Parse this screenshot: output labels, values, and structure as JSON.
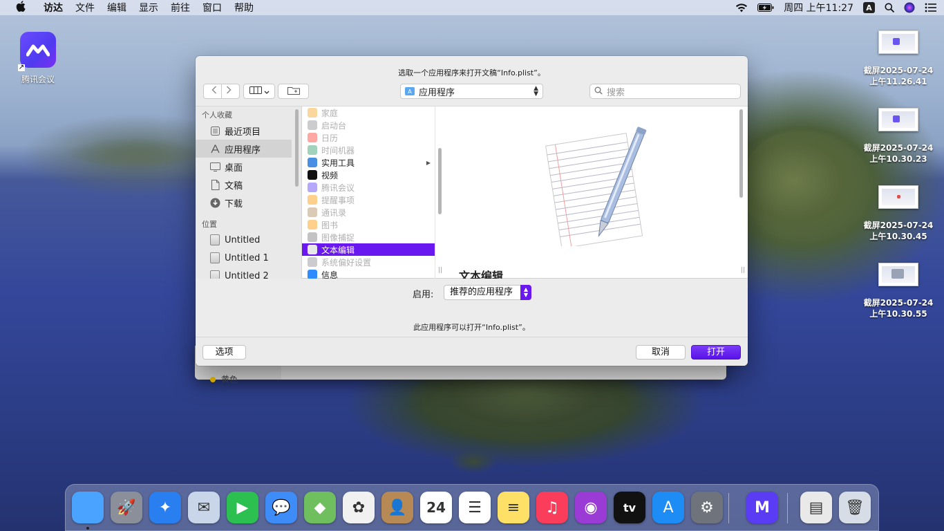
{
  "menubar": {
    "items": [
      "访达",
      "文件",
      "编辑",
      "显示",
      "前往",
      "窗口",
      "帮助"
    ],
    "clock": "周四 上午11:27",
    "input_method": "A"
  },
  "desktop": {
    "app_icon_label": "腾讯会议",
    "screenshots": [
      {
        "label_line1": "截屏2025-07-24",
        "label_line2": "上午11.26.41"
      },
      {
        "label_line1": "截屏2025-07-24",
        "label_line2": "上午10.30.23"
      },
      {
        "label_line1": "截屏2025-07-24",
        "label_line2": "上午10.30.45"
      },
      {
        "label_line1": "截屏2025-07-24",
        "label_line2": "上午10.30.55"
      }
    ]
  },
  "behind_window": {
    "sidebar_item": "黄色"
  },
  "dialog": {
    "title": "选取一个应用程序来打开文稿“Info.plist”。",
    "location": "应用程序",
    "search_placeholder": "搜索",
    "sidebar": {
      "favorites_header": "个人收藏",
      "favorites": [
        {
          "label": "最近项目",
          "icon": "clock-icon"
        },
        {
          "label": "应用程序",
          "icon": "applications-icon"
        },
        {
          "label": "桌面",
          "icon": "desktop-icon"
        },
        {
          "label": "文稿",
          "icon": "document-icon"
        },
        {
          "label": "下载",
          "icon": "download-icon"
        }
      ],
      "locations_header": "位置",
      "locations": [
        {
          "label": "Untitled",
          "icon": "disk-icon"
        },
        {
          "label": "Untitled 1",
          "icon": "disk-icon"
        },
        {
          "label": "Untitled 2",
          "icon": "disk-icon"
        }
      ]
    },
    "apps": [
      {
        "label": "家庭",
        "enabled": false,
        "color": "#f5a623"
      },
      {
        "label": "启动台",
        "enabled": false,
        "color": "#8e8e93"
      },
      {
        "label": "日历",
        "enabled": false,
        "color": "#ff3b30"
      },
      {
        "label": "时间机器",
        "enabled": false,
        "color": "#2f9e6a"
      },
      {
        "label": "实用工具",
        "enabled": true,
        "color": "#4a90e2",
        "folder": true
      },
      {
        "label": "视频",
        "enabled": true,
        "color": "#111111"
      },
      {
        "label": "腾讯会议",
        "enabled": false,
        "color": "#5b3cf5"
      },
      {
        "label": "提醒事项",
        "enabled": false,
        "color": "#ff9500"
      },
      {
        "label": "通讯录",
        "enabled": false,
        "color": "#b08a5a"
      },
      {
        "label": "图书",
        "enabled": false,
        "color": "#ff9500"
      },
      {
        "label": "图像捕捉",
        "enabled": false,
        "color": "#7a7a7a"
      },
      {
        "label": "文本编辑",
        "enabled": true,
        "selected": true,
        "color": "#e8e8e8"
      },
      {
        "label": "系统偏好设置",
        "enabled": false,
        "color": "#8e8e93"
      },
      {
        "label": "信息",
        "enabled": true,
        "color": "#2f8cff"
      }
    ],
    "preview_name": "文本编辑",
    "enable_label": "启用:",
    "enable_value": "推荐的应用程序",
    "info_text": "此应用程序可以打开“Info.plist”。",
    "options_button": "选项",
    "cancel_button": "取消",
    "open_button": "打开"
  },
  "dock": {
    "apps": [
      {
        "name": "finder-icon",
        "color": "#4aa3ff",
        "glyph": ""
      },
      {
        "name": "launchpad-icon",
        "color": "#8a8f99",
        "glyph": "🚀"
      },
      {
        "name": "safari-icon",
        "color": "#2a7ff0",
        "glyph": "✦"
      },
      {
        "name": "mail-icon",
        "color": "#c9d6ea",
        "glyph": "✉"
      },
      {
        "name": "facetime-icon",
        "color": "#2bc04f",
        "glyph": "▶"
      },
      {
        "name": "messages-icon",
        "color": "#3d8cf7",
        "glyph": "💬"
      },
      {
        "name": "maps-icon",
        "color": "#6fbf5f",
        "glyph": "◆"
      },
      {
        "name": "photos-icon",
        "color": "#f1f1f1",
        "glyph": "✿"
      },
      {
        "name": "contacts-icon",
        "color": "#b78a55",
        "glyph": "👤"
      },
      {
        "name": "calendar-icon",
        "color": "#ffffff",
        "glyph": "24"
      },
      {
        "name": "reminders-icon",
        "color": "#ffffff",
        "glyph": "☰"
      },
      {
        "name": "notes-icon",
        "color": "#ffe066",
        "glyph": "≡"
      },
      {
        "name": "music-icon",
        "color": "#fa3d5b",
        "glyph": "♫"
      },
      {
        "name": "podcasts-icon",
        "color": "#9b3bd6",
        "glyph": "◉"
      },
      {
        "name": "tv-icon",
        "color": "#111111",
        "glyph": "tv"
      },
      {
        "name": "appstore-icon",
        "color": "#1e8cf5",
        "glyph": "A"
      },
      {
        "name": "system-preferences-icon",
        "color": "#6f737b",
        "glyph": "⚙"
      },
      {
        "name": "tencent-meeting-icon",
        "color": "#5b3cf5",
        "glyph": "M"
      },
      {
        "name": "document-icon",
        "color": "#e9e9e9",
        "glyph": "▤"
      },
      {
        "name": "trash-icon",
        "color": "#d7dde6",
        "glyph": "🗑"
      }
    ]
  }
}
